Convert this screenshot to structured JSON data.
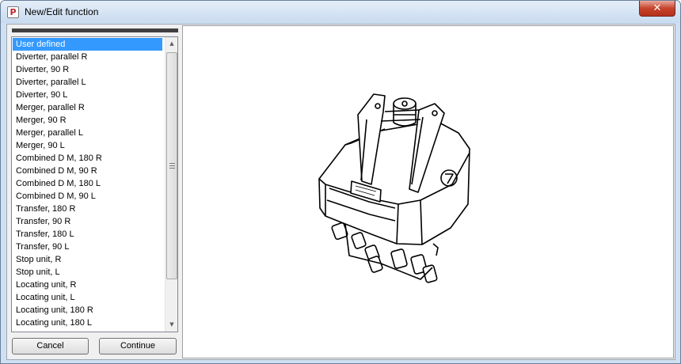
{
  "window": {
    "title": "New/Edit function",
    "icon_letter": "P",
    "close_glyph": "✕"
  },
  "list": {
    "selected_index": 0,
    "items": [
      "User defined",
      "Diverter, parallel R",
      "Diverter, 90 R",
      "Diverter, parallel L",
      "Diverter, 90 L",
      "Merger, parallel R",
      "Merger, 90 R",
      "Merger, parallel L",
      "Merger, 90 L",
      "Combined D M, 180 R",
      "Combined D M, 90 R",
      "Combined D M, 180 L",
      "Combined D M, 90 L",
      "Transfer, 180 R",
      "Transfer, 90 R",
      "Transfer, 180 L",
      "Transfer, 90 L",
      "Stop unit, R",
      "Stop unit, L",
      "Locating unit, R",
      "Locating unit, L",
      "Locating unit, 180 R",
      "Locating unit, 180 L"
    ]
  },
  "scrollbar": {
    "up_glyph": "▲",
    "down_glyph": "▼"
  },
  "buttons": {
    "cancel": "Cancel",
    "continue": "Continue"
  },
  "preview": {
    "image": "device-line-drawing"
  }
}
